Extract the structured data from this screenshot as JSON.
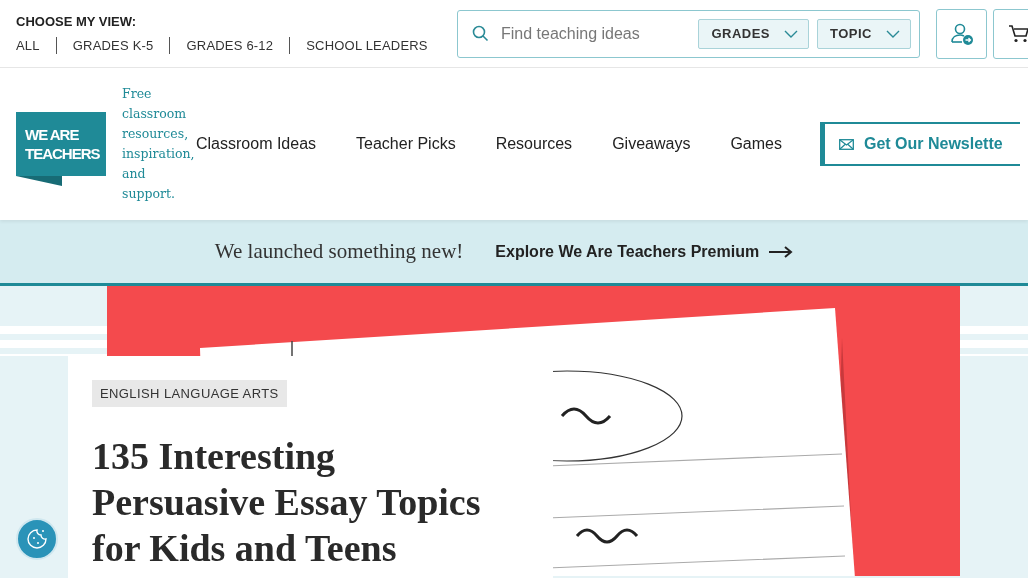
{
  "view_chooser": {
    "label": "CHOOSE MY VIEW:",
    "links": [
      "ALL",
      "GRADES K-5",
      "GRADES 6-12",
      "SCHOOL LEADERS"
    ]
  },
  "search": {
    "placeholder": "Find teaching ideas",
    "filters": [
      "GRADES",
      "TOPIC"
    ]
  },
  "logo": {
    "lines": [
      "WE ARE",
      "TEACHERS"
    ]
  },
  "tagline": "Free classroom resources, inspiration, and support.",
  "nav": [
    "Classroom Ideas",
    "Teacher Picks",
    "Resources",
    "Giveaways",
    "Games"
  ],
  "newsletter_button": "Get Our Newslette",
  "announcement": {
    "text": "We launched something new!",
    "link": "Explore We Are Teachers Premium"
  },
  "article": {
    "category": "ENGLISH LANGUAGE ARTS",
    "title": "135 Interesting Persuasive Essay Topics for Kids and Teens"
  }
}
